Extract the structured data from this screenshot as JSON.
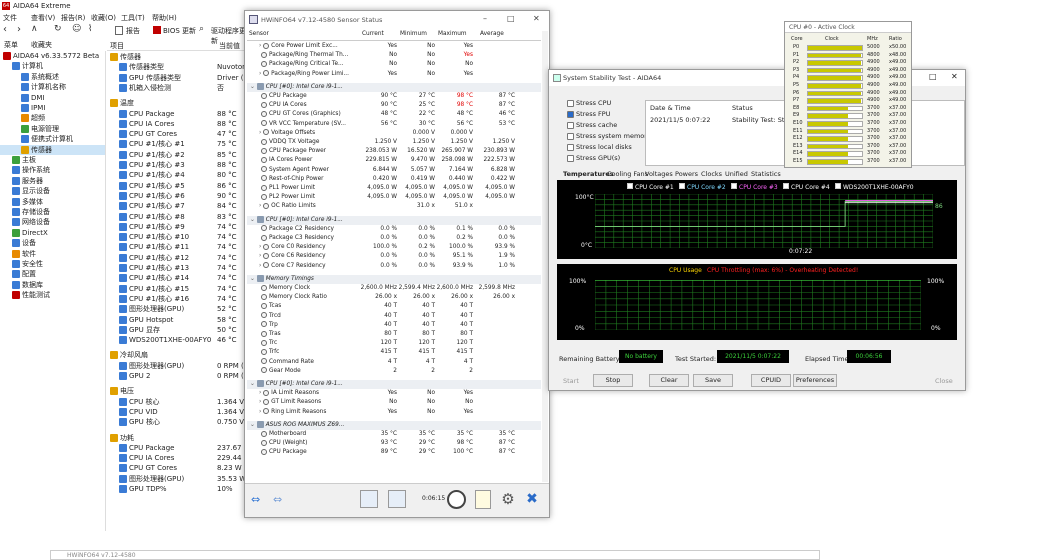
{
  "aida": {
    "title": "AIDA64 Extreme",
    "menu": [
      "文件",
      "查看(V)",
      "报告(R)",
      "收藏(O)",
      "工具(T)",
      "帮助(H)"
    ],
    "toolbar": [
      "报告",
      "BIOS 更新",
      "驱动程序更新"
    ],
    "tabs": [
      "菜单",
      "收藏夹"
    ],
    "col_item": "项目",
    "col_value": "当前值",
    "tree": [
      {
        "l": "AIDA64 v6.33.5772 Beta",
        "d": 0,
        "c": "#c00000"
      },
      {
        "l": "计算机",
        "d": 1,
        "c": "#3a7bd5"
      },
      {
        "l": "系统概述",
        "d": 2,
        "c": "#3a7bd5"
      },
      {
        "l": "计算机名称",
        "d": 2,
        "c": "#3a7bd5"
      },
      {
        "l": "DMI",
        "d": 2,
        "c": "#3a7bd5"
      },
      {
        "l": "IPMI",
        "d": 2,
        "c": "#3a7bd5"
      },
      {
        "l": "超频",
        "d": 2,
        "c": "#e88a00"
      },
      {
        "l": "电源管理",
        "d": 2,
        "c": "#3ca03c"
      },
      {
        "l": "便携式计算机",
        "d": 2,
        "c": "#3a7bd5"
      },
      {
        "l": "传感器",
        "d": 2,
        "c": "#e0a000"
      },
      {
        "l": "主板",
        "d": 1,
        "c": "#3ca03c"
      },
      {
        "l": "操作系统",
        "d": 1,
        "c": "#3a7bd5"
      },
      {
        "l": "服务器",
        "d": 1,
        "c": "#3a7bd5"
      },
      {
        "l": "显示设备",
        "d": 1,
        "c": "#3a7bd5"
      },
      {
        "l": "多媒体",
        "d": 1,
        "c": "#3a7bd5"
      },
      {
        "l": "存储设备",
        "d": 1,
        "c": "#3a7bd5"
      },
      {
        "l": "网络设备",
        "d": 1,
        "c": "#3a7bd5"
      },
      {
        "l": "DirectX",
        "d": 1,
        "c": "#3ca03c"
      },
      {
        "l": "设备",
        "d": 1,
        "c": "#3a7bd5"
      },
      {
        "l": "软件",
        "d": 1,
        "c": "#e88a00"
      },
      {
        "l": "安全性",
        "d": 1,
        "c": "#3a7bd5"
      },
      {
        "l": "配置",
        "d": 1,
        "c": "#3a7bd5"
      },
      {
        "l": "数据库",
        "d": 1,
        "c": "#3a7bd5"
      },
      {
        "l": "性能测试",
        "d": 1,
        "c": "#c00000"
      }
    ],
    "sensor_rows": [
      {
        "t": "h",
        "l": "传感器"
      },
      {
        "l": "传感器类型",
        "v": "Nuvoton"
      },
      {
        "l": "GPU 传感器类型",
        "v": "Driver (N"
      },
      {
        "l": "机箱入侵检测",
        "v": "否"
      },
      {
        "t": "gap"
      },
      {
        "t": "h",
        "l": "温度"
      },
      {
        "l": "CPU Package",
        "v": "88 °C"
      },
      {
        "l": "CPU IA Cores",
        "v": "88 °C"
      },
      {
        "l": "CPU GT Cores",
        "v": "47 °C"
      },
      {
        "l": "CPU #1/核心 #1",
        "v": "75 °C"
      },
      {
        "l": "CPU #1/核心 #2",
        "v": "85 °C"
      },
      {
        "l": "CPU #1/核心 #3",
        "v": "88 °C"
      },
      {
        "l": "CPU #1/核心 #4",
        "v": "80 °C"
      },
      {
        "l": "CPU #1/核心 #5",
        "v": "86 °C"
      },
      {
        "l": "CPU #1/核心 #6",
        "v": "90 °C"
      },
      {
        "l": "CPU #1/核心 #7",
        "v": "84 °C"
      },
      {
        "l": "CPU #1/核心 #8",
        "v": "83 °C"
      },
      {
        "l": "CPU #1/核心 #9",
        "v": "74 °C"
      },
      {
        "l": "CPU #1/核心 #10",
        "v": "74 °C"
      },
      {
        "l": "CPU #1/核心 #11",
        "v": "74 °C"
      },
      {
        "l": "CPU #1/核心 #12",
        "v": "74 °C"
      },
      {
        "l": "CPU #1/核心 #13",
        "v": "74 °C"
      },
      {
        "l": "CPU #1/核心 #14",
        "v": "74 °C"
      },
      {
        "l": "CPU #1/核心 #15",
        "v": "74 °C"
      },
      {
        "l": "CPU #1/核心 #16",
        "v": "74 °C"
      },
      {
        "l": "图形处理器(GPU)",
        "v": "52 °C"
      },
      {
        "l": "GPU Hotspot",
        "v": "58 °C"
      },
      {
        "l": "GPU 显存",
        "v": "50 °C"
      },
      {
        "l": "WDS200T1XHE-00AFY0",
        "v": "46 °C"
      },
      {
        "t": "gap"
      },
      {
        "t": "h",
        "l": "冷却风扇"
      },
      {
        "l": "图形处理器(GPU)",
        "v": "0 RPM (0"
      },
      {
        "l": "GPU 2",
        "v": "0 RPM (0"
      },
      {
        "t": "gap"
      },
      {
        "t": "h",
        "l": "电压"
      },
      {
        "l": "CPU 核心",
        "v": "1.364 V"
      },
      {
        "l": "CPU VID",
        "v": "1.364 V"
      },
      {
        "l": "GPU 核心",
        "v": "0.750 V"
      },
      {
        "t": "gap"
      },
      {
        "t": "h",
        "l": "功耗"
      },
      {
        "l": "CPU Package",
        "v": "237.67 W"
      },
      {
        "l": "CPU IA Cores",
        "v": "229.44 W"
      },
      {
        "l": "CPU GT Cores",
        "v": "8.23 W"
      },
      {
        "l": "图形处理器(GPU)",
        "v": "35.53 W"
      },
      {
        "l": "GPU TDP%",
        "v": "10%"
      }
    ]
  },
  "hw": {
    "title": "HWiNFO64 v7.12-4580 Sensor Status",
    "cols": [
      "Sensor",
      "Current",
      "Minimum",
      "Maximum",
      "Average"
    ],
    "rows": [
      {
        "l": "Core Power Limit Exc...",
        "v": [
          "Yes",
          "No",
          "Yes",
          ""
        ],
        "e": 1
      },
      {
        "l": "Package/Ring Thermal Th...",
        "v": [
          "No",
          "No",
          "Yes",
          ""
        ],
        "r": 2
      },
      {
        "l": "Package/Ring Critical Te...",
        "v": [
          "No",
          "No",
          "No",
          ""
        ]
      },
      {
        "l": "Package/Ring Power Limi...",
        "v": [
          "Yes",
          "No",
          "Yes",
          ""
        ],
        "e": 1
      },
      {
        "t": "gap"
      },
      {
        "t": "h",
        "l": "CPU [#0]: Intel Core i9-1..."
      },
      {
        "l": "CPU Package",
        "v": [
          "90 °C",
          "27 °C",
          "98 °C",
          "87 °C"
        ],
        "r": 2
      },
      {
        "l": "CPU IA Cores",
        "v": [
          "90 °C",
          "25 °C",
          "98 °C",
          "87 °C"
        ],
        "r": 2
      },
      {
        "l": "CPU GT Cores (Graphics)",
        "v": [
          "48 °C",
          "22 °C",
          "48 °C",
          "46 °C"
        ]
      },
      {
        "l": "VR VCC Temperature (SV...",
        "v": [
          "56 °C",
          "30 °C",
          "56 °C",
          "53 °C"
        ]
      },
      {
        "l": "Voltage Offsets",
        "v": [
          "",
          "0.000 V",
          "0.000 V",
          ""
        ],
        "e": 1
      },
      {
        "l": "VDDQ TX Voltage",
        "v": [
          "1.250 V",
          "1.250 V",
          "1.250 V",
          "1.250 V"
        ]
      },
      {
        "l": "CPU Package Power",
        "v": [
          "238.053 W",
          "16.520 W",
          "265.907 W",
          "230.893 W"
        ]
      },
      {
        "l": "IA Cores Power",
        "v": [
          "229.815 W",
          "9.470 W",
          "258.098 W",
          "222.573 W"
        ]
      },
      {
        "l": "System Agent Power",
        "v": [
          "6.844 W",
          "5.057 W",
          "7.164 W",
          "6.828 W"
        ]
      },
      {
        "l": "Rest-of-Chip Power",
        "v": [
          "0.420 W",
          "0.419 W",
          "0.440 W",
          "0.422 W"
        ]
      },
      {
        "l": "PL1 Power Limit",
        "v": [
          "4,095.0 W",
          "4,095.0 W",
          "4,095.0 W",
          "4,095.0 W"
        ]
      },
      {
        "l": "PL2 Power Limit",
        "v": [
          "4,095.0 W",
          "4,095.0 W",
          "4,095.0 W",
          "4,095.0 W"
        ]
      },
      {
        "l": "OC Ratio Limits",
        "v": [
          "",
          "31.0 x",
          "51.0 x",
          ""
        ],
        "e": 1
      },
      {
        "t": "gap"
      },
      {
        "t": "h",
        "l": "CPU [#0]: Intel Core i9-1..."
      },
      {
        "l": "Package C2 Residency",
        "v": [
          "0.0 %",
          "0.0 %",
          "0.1 %",
          "0.0 %"
        ]
      },
      {
        "l": "Package C3 Residency",
        "v": [
          "0.0 %",
          "0.0 %",
          "0.2 %",
          "0.0 %"
        ]
      },
      {
        "l": "Core C0 Residency",
        "v": [
          "100.0 %",
          "0.2 %",
          "100.0 %",
          "93.9 %"
        ],
        "e": 1
      },
      {
        "l": "Core C6 Residency",
        "v": [
          "0.0 %",
          "0.0 %",
          "95.1 %",
          "1.9 %"
        ],
        "e": 1
      },
      {
        "l": "Core C7 Residency",
        "v": [
          "0.0 %",
          "0.0 %",
          "93.9 %",
          "1.0 %"
        ],
        "e": 1
      },
      {
        "t": "gap"
      },
      {
        "t": "h",
        "l": "Memory Timings"
      },
      {
        "l": "Memory Clock",
        "v": [
          "2,600.0 MHz",
          "2,599.4 MHz",
          "2,600.0 MHz",
          "2,599.8 MHz"
        ]
      },
      {
        "l": "Memory Clock Ratio",
        "v": [
          "26.00 x",
          "26.00 x",
          "26.00 x",
          "26.00 x"
        ]
      },
      {
        "l": "Tcas",
        "v": [
          "40 T",
          "40 T",
          "40 T",
          ""
        ]
      },
      {
        "l": "Trcd",
        "v": [
          "40 T",
          "40 T",
          "40 T",
          ""
        ]
      },
      {
        "l": "Trp",
        "v": [
          "40 T",
          "40 T",
          "40 T",
          ""
        ]
      },
      {
        "l": "Tras",
        "v": [
          "80 T",
          "80 T",
          "80 T",
          ""
        ]
      },
      {
        "l": "Trc",
        "v": [
          "120 T",
          "120 T",
          "120 T",
          ""
        ]
      },
      {
        "l": "Trfc",
        "v": [
          "415 T",
          "415 T",
          "415 T",
          ""
        ]
      },
      {
        "l": "Command Rate",
        "v": [
          "4 T",
          "4 T",
          "4 T",
          ""
        ]
      },
      {
        "l": "Gear Mode",
        "v": [
          "2",
          "2",
          "2",
          ""
        ]
      },
      {
        "t": "gap"
      },
      {
        "t": "h",
        "l": "CPU [#0]: Intel Core i9-1..."
      },
      {
        "l": "IA Limit Reasons",
        "v": [
          "Yes",
          "No",
          "Yes",
          ""
        ],
        "e": 1
      },
      {
        "l": "GT Limit Reasons",
        "v": [
          "No",
          "No",
          "No",
          ""
        ],
        "e": 1
      },
      {
        "l": "Ring Limit Reasons",
        "v": [
          "Yes",
          "No",
          "Yes",
          ""
        ],
        "e": 1
      },
      {
        "t": "gap"
      },
      {
        "t": "h",
        "l": "ASUS ROG MAXIMUS Z69..."
      },
      {
        "l": "Motherboard",
        "v": [
          "35 °C",
          "35 °C",
          "35 °C",
          "35 °C"
        ]
      },
      {
        "l": "CPU (Weight)",
        "v": [
          "93 °C",
          "29 °C",
          "98 °C",
          "87 °C"
        ]
      },
      {
        "l": "CPU Package",
        "v": [
          "89 °C",
          "29 °C",
          "100 °C",
          "87 °C"
        ]
      }
    ],
    "clock": "0:06:15"
  },
  "clk": {
    "title": "CPU #0 - Active Clock",
    "cols": [
      "Core",
      "Clock",
      "MHz",
      "Ratio"
    ],
    "rows": [
      {
        "c": "P0",
        "p": 1.0,
        "m": "5000",
        "r": "x50.00"
      },
      {
        "c": "P1",
        "p": 0.98,
        "m": "4800",
        "r": "x48.00"
      },
      {
        "c": "P2",
        "p": 0.98,
        "m": "4900",
        "r": "x49.00"
      },
      {
        "c": "P3",
        "p": 0.98,
        "m": "4900",
        "r": "x49.00"
      },
      {
        "c": "P4",
        "p": 0.98,
        "m": "4900",
        "r": "x49.00"
      },
      {
        "c": "P5",
        "p": 0.98,
        "m": "4900",
        "r": "x49.00"
      },
      {
        "c": "P6",
        "p": 0.98,
        "m": "4900",
        "r": "x49.00"
      },
      {
        "c": "P7",
        "p": 0.98,
        "m": "4900",
        "r": "x49.00"
      },
      {
        "c": "E8",
        "p": 0.74,
        "m": "3700",
        "r": "x37.00"
      },
      {
        "c": "E9",
        "p": 0.74,
        "m": "3700",
        "r": "x37.00"
      },
      {
        "c": "E10",
        "p": 0.74,
        "m": "3700",
        "r": "x37.00"
      },
      {
        "c": "E11",
        "p": 0.74,
        "m": "3700",
        "r": "x37.00"
      },
      {
        "c": "E12",
        "p": 0.74,
        "m": "3700",
        "r": "x37.00"
      },
      {
        "c": "E13",
        "p": 0.74,
        "m": "3700",
        "r": "x37.00"
      },
      {
        "c": "E14",
        "p": 0.74,
        "m": "3700",
        "r": "x37.00"
      },
      {
        "c": "E15",
        "p": 0.74,
        "m": "3700",
        "r": "x37.00"
      }
    ]
  },
  "sst": {
    "title": "System Stability Test - AIDA64",
    "stress": [
      {
        "l": "Stress CPU",
        "ck": false
      },
      {
        "l": "Stress FPU",
        "ck": true
      },
      {
        "l": "Stress cache",
        "ck": false
      },
      {
        "l": "Stress system memory",
        "ck": false
      },
      {
        "l": "Stress local disks",
        "ck": false
      },
      {
        "l": "Stress GPU(s)",
        "ck": false
      }
    ],
    "col_date": "Date & Time",
    "col_status": "Status",
    "date": "2021/11/5 0:07:22",
    "status": "Stability Test: Started",
    "tabs": [
      "Temperatures",
      "Cooling Fans",
      "Voltages",
      "Powers",
      "Clocks",
      "Unified",
      "Statistics"
    ],
    "legend": [
      "CPU Core #1",
      "CPU Core #2",
      "CPU Core #3",
      "CPU Core #4",
      "WDS200T1XHE-00AFY0"
    ],
    "t_top": "100°C",
    "t_bot": "0°C",
    "t_time": "0:07:22",
    "t_val": "86",
    "usage_title": "CPU Usage",
    "throttle": "CPU Throttling (max: 6%) - Overheating Detected!",
    "u_top": "100%",
    "u_bot": "0%",
    "u_top_r": "100%",
    "u_bot_r": "0%",
    "battery_l": "Remaining Battery:",
    "battery_v": "No battery",
    "started_l": "Test Started:",
    "started_v": "2021/11/5 0:07:22",
    "elapsed_l": "Elapsed Time:",
    "elapsed_v": "00:06:56",
    "buttons": [
      "Start",
      "Stop",
      "Clear",
      "Save",
      "CPUID",
      "Preferences",
      "Close"
    ]
  },
  "bottom_title": "HWiNFO64 v7.12-4580"
}
